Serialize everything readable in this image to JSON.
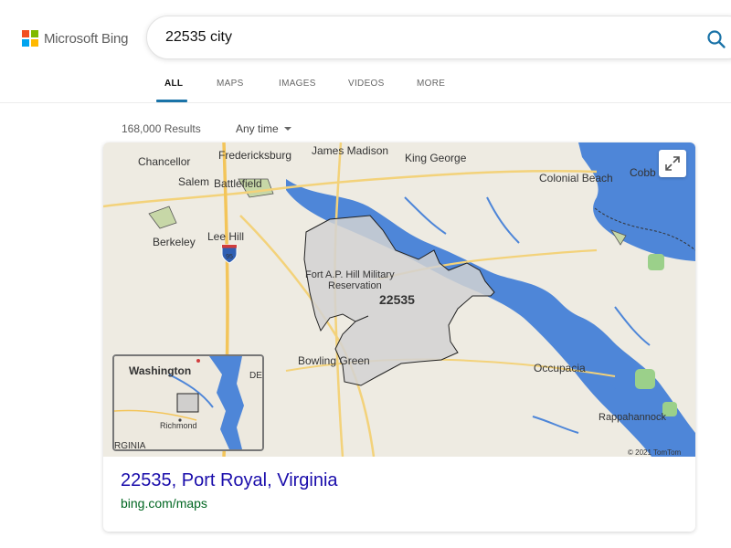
{
  "brand": {
    "name": "Microsoft Bing",
    "colors": [
      "#f25022",
      "#7fba00",
      "#00a4ef",
      "#ffb900"
    ]
  },
  "search": {
    "query": "22535 city",
    "icon": "search-icon"
  },
  "nav": {
    "tabs": [
      "ALL",
      "MAPS",
      "IMAGES",
      "VIDEOS",
      "MORE"
    ],
    "active": "ALL"
  },
  "results_bar": {
    "count": "168,000 Results",
    "time_filter": "Any time"
  },
  "map": {
    "places": [
      "Chancellor",
      "Fredericksburg",
      "James Madison",
      "King George",
      "Colonial Beach",
      "Cobb",
      "Salem",
      "Battlefield",
      "Lee Hill",
      "Berkeley",
      "Fort A.P. Hill Military",
      "Reservation",
      "22535",
      "Bowling Green",
      "Occupacia",
      "Rappahannock"
    ],
    "highway_shield": "95",
    "inset": {
      "labels": [
        "Washington",
        "DE",
        "Richmond",
        "RGINIA"
      ]
    },
    "attribution": "© 2021 TomTom",
    "expand_icon": "expand-icon"
  },
  "result": {
    "title": "22535, Port Royal, Virginia",
    "url": "bing.com/maps"
  },
  "colors": {
    "link": "#1a0dab",
    "url": "#006621",
    "accent": "#1a73a8",
    "water": "#4e86d8",
    "land": "#eeebe2"
  }
}
